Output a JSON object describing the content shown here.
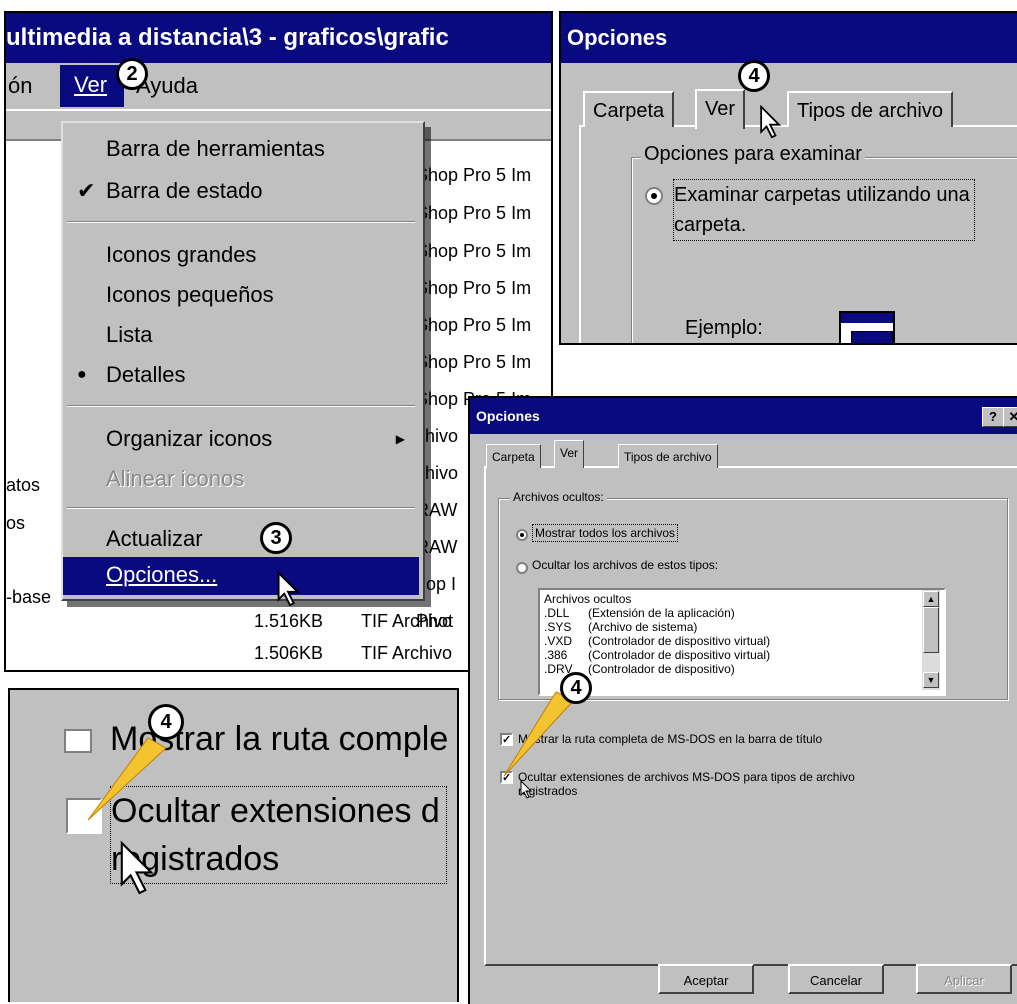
{
  "explorer": {
    "title": "ultimedia a distancia\\3 - graficos\\grafic",
    "menubar": [
      "ón",
      "Ver",
      "Ayuda"
    ],
    "view_menu": {
      "items": [
        {
          "label": "Barra de herramientas",
          "mark": ""
        },
        {
          "label": "Barra de estado",
          "mark": "✔"
        },
        {
          "label": "Iconos grandes",
          "mark": ""
        },
        {
          "label": "Iconos pequeños",
          "mark": ""
        },
        {
          "label": "Lista",
          "mark": ""
        },
        {
          "label": "Detalles",
          "mark": "●"
        },
        {
          "label": "Organizar iconos",
          "mark": "",
          "submenu": "▶"
        },
        {
          "label": "Alinear iconos",
          "mark": "",
          "disabled": true
        },
        {
          "label": "Actualizar",
          "mark": ""
        },
        {
          "label": "Opciones...",
          "mark": "",
          "selected": true
        }
      ]
    },
    "file_rows_right": [
      "Shop Pro 5 Im",
      "Shop Pro 5 Im",
      "Shop Pro 5 Im",
      "Shop Pro 5 Im",
      "Shop Pro 5 Im",
      "Shop Pro 5 Im",
      "Shop Pro 5 Im",
      "chivo",
      "chivo",
      "RAW",
      "RAW",
      "hop I",
      "Phot"
    ],
    "file_rows_left": [
      "atos",
      "os",
      "-base"
    ],
    "bottom_rows": [
      {
        "size": "1.516KB",
        "type": "TIF Archivo"
      },
      {
        "size": "1.506KB",
        "type": "TIF Archivo"
      }
    ]
  },
  "options_zoom": {
    "title": "Opciones",
    "tabs": [
      "Carpeta",
      "Ver",
      "Tipos de archivo"
    ],
    "group_label": "Opciones para examinar",
    "radio_label_1": "Examinar carpetas utilizando una",
    "radio_label_2": "carpeta.",
    "example_label": "Ejemplo:"
  },
  "checkbox_zoom": {
    "top_partial": "Mostrar la ruta comple",
    "label_1": "Ocultar extensiones d",
    "label_2": "registrados"
  },
  "options_dialog": {
    "title": "Opciones",
    "help_btn": "?",
    "close_btn": "✕",
    "tabs": [
      "Carpeta",
      "Ver",
      "Tipos de archivo"
    ],
    "group_label": "Archivos ocultos:",
    "radio_show_all": "Mostrar todos los archivos",
    "radio_hide_types": "Ocultar los archivos de estos tipos:",
    "list_header": "Archivos ocultos",
    "list_rows": [
      {
        "ext": ".DLL",
        "desc": "(Extensión de la aplicación)"
      },
      {
        "ext": ".SYS",
        "desc": "(Archivo de sistema)"
      },
      {
        "ext": ".VXD",
        "desc": "(Controlador de dispositivo virtual)"
      },
      {
        "ext": ".386",
        "desc": "(Controlador de dispositivo virtual)"
      },
      {
        "ext": ".DRV",
        "desc": "(Controlador de dispositivo)"
      }
    ],
    "chk_full_path": "Mostrar la ruta completa de MS-DOS en la barra de título",
    "chk_hide_ext_1": "Ocultar extensiones de archivos MS-DOS para tipos de archivo",
    "chk_hide_ext_2": "registrados",
    "btn_ok": "Aceptar",
    "btn_cancel": "Cancelar",
    "btn_apply": "Aplicar"
  },
  "badges": {
    "step2": "2",
    "step3": "3",
    "step4a": "4",
    "step4b": "4",
    "step4c": "4"
  },
  "colors": {
    "titlebar": "#0a0a80",
    "face": "#c0c0c0",
    "pointer": "#f4c430"
  }
}
